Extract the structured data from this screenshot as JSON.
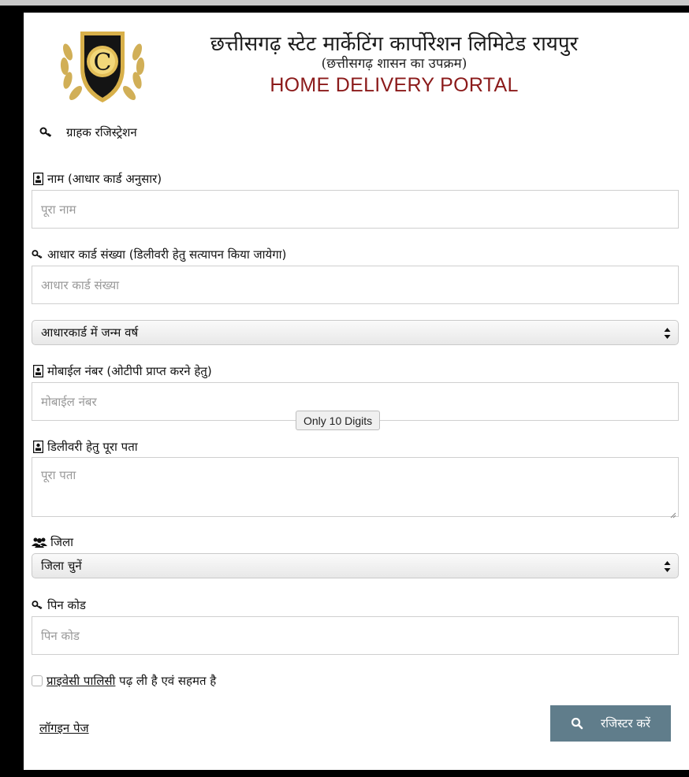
{
  "header": {
    "title": "छत्तीसगढ़ स्टेट मार्केटिंग कार्पोरेशन लिमिटेड रायपुर",
    "subtitle": "(छत्तीसगढ़ शासन का उपक्रम)",
    "portal": "HOME DELIVERY PORTAL",
    "logo_letter": "C"
  },
  "form": {
    "section_title": "ग्राहक रजिस्ट्रेशन",
    "name": {
      "label": "नाम (आधार कार्ड अनुसार)",
      "placeholder": "पूरा नाम",
      "value": ""
    },
    "aadhaar": {
      "label": "आधार कार्ड संख्या (डिलीवरी हेतु सत्यापन किया जायेगा)",
      "placeholder": "आधार कार्ड संख्या",
      "value": ""
    },
    "birth_year": {
      "selected": "आधारकार्ड में जन्म वर्ष"
    },
    "mobile": {
      "label": "मोबाईल नंबर (ओटीपी प्राप्त करने हेतु)",
      "placeholder": "मोबाईल नंबर",
      "value": "",
      "tooltip": "Only 10 Digits"
    },
    "address": {
      "label": "डिलीवरी हेतु पूरा पता",
      "placeholder": "पूरा पता",
      "value": ""
    },
    "district": {
      "label": "जिला",
      "selected": "जिला चुनें"
    },
    "pincode": {
      "label": "पिन कोड",
      "placeholder": "पिन कोड",
      "value": ""
    },
    "consent": {
      "link": "प्राइवेसी पालिसी",
      "text": " पढ़ ली है एवं सहमत है"
    },
    "login_link": "लॉगइन पेज",
    "submit_label": "रजिस्टर करें"
  },
  "icons": {
    "section": "key-icon",
    "name": "id-card-icon",
    "aadhaar": "key-icon",
    "mobile": "id-card-icon",
    "address": "id-card-icon",
    "district": "users-icon",
    "pincode": "key-icon",
    "submit": "search-icon"
  },
  "colors": {
    "portal_text": "#8b1a1a",
    "button": "#607d8b",
    "logo_gold": "#c9a23a"
  }
}
